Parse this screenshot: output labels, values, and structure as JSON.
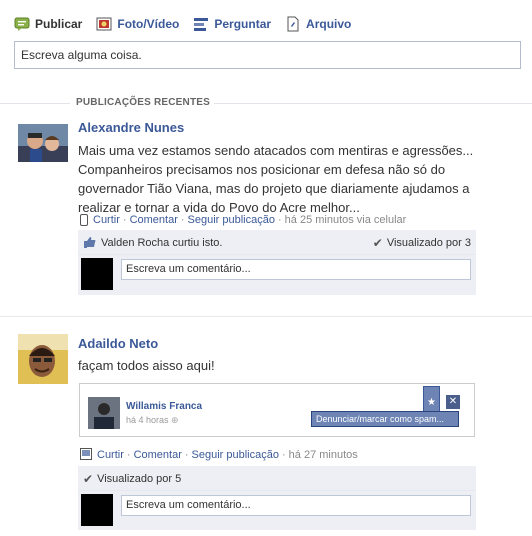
{
  "composer": {
    "tabs": [
      {
        "label": "Publicar",
        "icon": "status-icon"
      },
      {
        "label": "Foto/Vídeo",
        "icon": "photo-icon"
      },
      {
        "label": "Perguntar",
        "icon": "question-icon"
      },
      {
        "label": "Arquivo",
        "icon": "file-icon"
      }
    ],
    "input_value": "Escreva alguma coisa."
  },
  "section_title": "PUBLICAÇÕES RECENTES",
  "stories": [
    {
      "author": "Alexandre Nunes",
      "message_lines": [
        "Mais uma vez estamos sendo atacados com mentiras e agressões...",
        "Companheiros precisamos nos posicionar em defesa não só do",
        "governador Tião Viana, mas do projeto que diariamente ajudamos a",
        "realizar e tornar a vida do Povo do Acre melhor..."
      ],
      "actions": {
        "like": "Curtir",
        "comment": "Comentar",
        "follow": "Seguir publicação",
        "timestamp": "há 25 minutos via celular"
      },
      "likes_text": "Valden Rocha curtiu isto.",
      "seen_text": "Visualizado por 3",
      "comment_placeholder": "Escreva um comentário..."
    },
    {
      "author": "Adaildo Neto",
      "message_lines": [
        "façam todos aisso aqui!"
      ],
      "shared": {
        "name": "Willamis Franca",
        "time": "há 4 horas",
        "menu_label": "Denunciar/marcar como spam..."
      },
      "actions": {
        "like": "Curtir",
        "comment": "Comentar",
        "follow": "Seguir publicação",
        "timestamp": "há 27 minutos"
      },
      "seen_text": "Visualizado por 5",
      "comment_placeholder": "Escreva um comentário..."
    }
  ],
  "colors": {
    "link": "#3b5998",
    "ufi_bg": "#edeff4",
    "border": "#b4bbcd"
  }
}
